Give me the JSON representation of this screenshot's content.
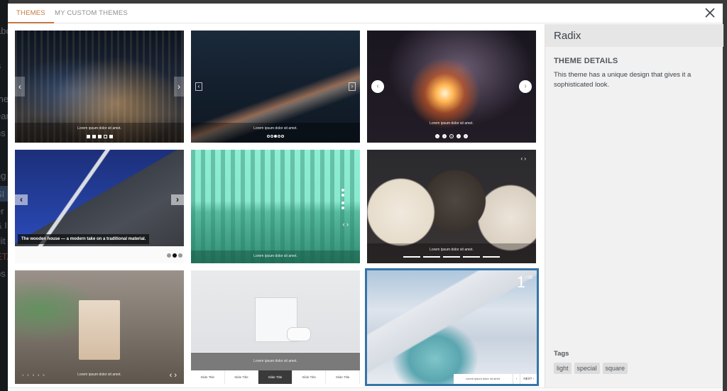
{
  "background_sidebar": {
    "fragments": [
      "abo",
      "s",
      "a",
      "s",
      "me",
      "ear",
      "ns",
      "s",
      "s",
      "ng",
      "SI",
      "er",
      "& I",
      "dit",
      "ETA",
      "ps"
    ]
  },
  "modal": {
    "tabs": [
      {
        "label": "THEMES",
        "active": true
      },
      {
        "label": "MY CUSTOM THEMES",
        "active": false
      }
    ],
    "close_icon": "close-icon"
  },
  "themes": [
    {
      "name": "city-night",
      "caption": "Lorem ipsum dolor sit amet.",
      "dots": 5,
      "active_dot": 4
    },
    {
      "name": "highway-night",
      "caption": "Lorem ipsum dolor sit amet.",
      "dots": 5,
      "active_dot": 3
    },
    {
      "name": "sparkler",
      "caption": "Lorem ipsum dolor sit amet.",
      "dots": [
        "1",
        "2",
        "3",
        "4",
        "5"
      ],
      "active_dot": 3
    },
    {
      "name": "building",
      "caption": "The wooden house — a modern take on a traditional material.",
      "dots": 3,
      "active_dot": 2
    },
    {
      "name": "teal-skyline",
      "caption": "Lorem ipsum dolor sit amet.",
      "dots": 4
    },
    {
      "name": "bags",
      "caption": "Lorem ipsum dolor sit amet.",
      "dots": 5
    },
    {
      "name": "coffee",
      "caption": "Lorem ipsum dolor sit amet.",
      "numbers": "1 2 3 4 5"
    },
    {
      "name": "console",
      "caption": "Lorem ipsum dolor sit amet.",
      "slide_titles": [
        "Slide Title",
        "Slide Title",
        "Slide Title",
        "Slide Title",
        "Slide Title"
      ],
      "active_title": 3
    },
    {
      "name": "plane",
      "caption": "Lorem ipsum dolor sit amet.",
      "counter_current": "1",
      "counter_total": "/ 05",
      "prev_label": "‹",
      "next_label": "NEXT ›",
      "selected": true
    }
  ],
  "details": {
    "title": "Radix",
    "heading": "THEME DETAILS",
    "description": "This theme has a unique design that gives it a sophisticated look.",
    "tags_label": "Tags",
    "tags": [
      "light",
      "special",
      "square"
    ]
  },
  "colors": {
    "accent": "#c4773f",
    "selected_border": "#3574a8"
  }
}
